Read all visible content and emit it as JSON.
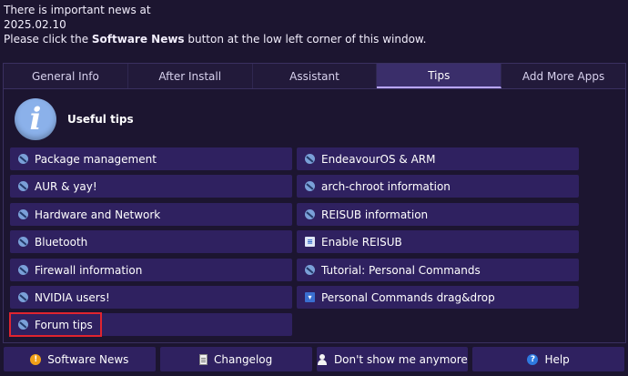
{
  "news": {
    "line1": "There is important news at",
    "line2": "2025.02.10",
    "line3_pre": "Please click the ",
    "line3_bold": "Software News",
    "line3_post": " button at the low left corner of this window."
  },
  "tabs": [
    {
      "label": "General Info"
    },
    {
      "label": "After Install"
    },
    {
      "label": "Assistant"
    },
    {
      "label": "Tips",
      "active": true
    },
    {
      "label": "Add More Apps"
    }
  ],
  "header": {
    "title": "Useful tips",
    "icon": "info-icon"
  },
  "tips_left": [
    {
      "label": "Package management",
      "icon": "no-entry-icon"
    },
    {
      "label": "AUR & yay!",
      "icon": "no-entry-icon"
    },
    {
      "label": "Hardware and Network",
      "icon": "no-entry-icon"
    },
    {
      "label": "Bluetooth",
      "icon": "no-entry-icon"
    },
    {
      "label": "Firewall information",
      "icon": "no-entry-icon"
    },
    {
      "label": "NVIDIA users!",
      "icon": "no-entry-icon"
    },
    {
      "label": "Forum tips",
      "icon": "no-entry-icon",
      "highlighted": true
    }
  ],
  "tips_right": [
    {
      "label": "EndeavourOS & ARM",
      "icon": "no-entry-icon"
    },
    {
      "label": "arch-chroot information",
      "icon": "no-entry-icon"
    },
    {
      "label": "REISUB information",
      "icon": "no-entry-icon"
    },
    {
      "label": "Enable REISUB",
      "icon": "document-icon"
    },
    {
      "label": "Tutorial: Personal Commands",
      "icon": "no-entry-icon"
    },
    {
      "label": "Personal Commands drag&drop",
      "icon": "down-arrow-icon"
    }
  ],
  "bottom": {
    "software_news": "Software News",
    "changelog": "Changelog",
    "dont_show": "Don't show me anymore",
    "help": "Help"
  },
  "colors": {
    "background": "#1c1530",
    "button": "#2f2160",
    "active_tab": "#3a2e6a",
    "highlight": "#e0242f"
  }
}
